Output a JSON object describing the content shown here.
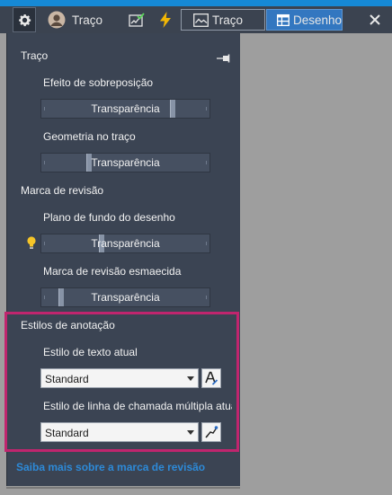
{
  "colors": {
    "accent": "#1689d6",
    "panel_bg": "#3b4453",
    "toolbar_bg": "#3b4350",
    "active_segment": "#3377c0",
    "highlight_border": "#c0256e",
    "link": "#2d8ad8",
    "canvas_bg": "#9e9e9e"
  },
  "toolbar": {
    "settings_icon": "gear-icon",
    "avatar_icon": "user-avatar-icon",
    "user_label": "Traço",
    "checklist_icon": "checked-chart-icon",
    "flash_icon": "lightning-icon",
    "segments": [
      {
        "label": "Traço",
        "icon": "trace-icon",
        "active": false
      },
      {
        "label": "Desenho",
        "icon": "grid-icon",
        "active": true
      }
    ],
    "close_icon": "close-icon"
  },
  "panel": {
    "title": "Traço",
    "pin_icon": "pin-icon",
    "sections": {
      "trace": {
        "overlay_effect_label": "Efeito de sobreposição",
        "overlay_effect_slider": {
          "text": "Transparência",
          "level": 0.78
        },
        "geometry_label": "Geometria no traço",
        "geometry_slider": {
          "text": "Transparência",
          "level": 0.28
        }
      },
      "revision": {
        "title": "Marca de revisão",
        "background_label": "Plano de fundo do desenho",
        "background_icon": "lightbulb-icon",
        "background_slider": {
          "text": "Transparência",
          "level": 0.36
        },
        "faded_label": "Marca de revisão esmaecida",
        "faded_slider": {
          "text": "Transparência",
          "level": 0.12
        }
      },
      "annotation": {
        "title": "Estilos de anotação",
        "text_style_label": "Estilo de texto atual",
        "text_style_value": "Standard",
        "text_style_button_icon": "text-style-icon",
        "mleader_style_label": "Estilo de linha de chamada múltipla atual",
        "mleader_style_value": "Standard",
        "mleader_style_button_icon": "multileader-icon"
      }
    },
    "learn_more_link": "Saiba mais sobre a marca de revisão"
  }
}
